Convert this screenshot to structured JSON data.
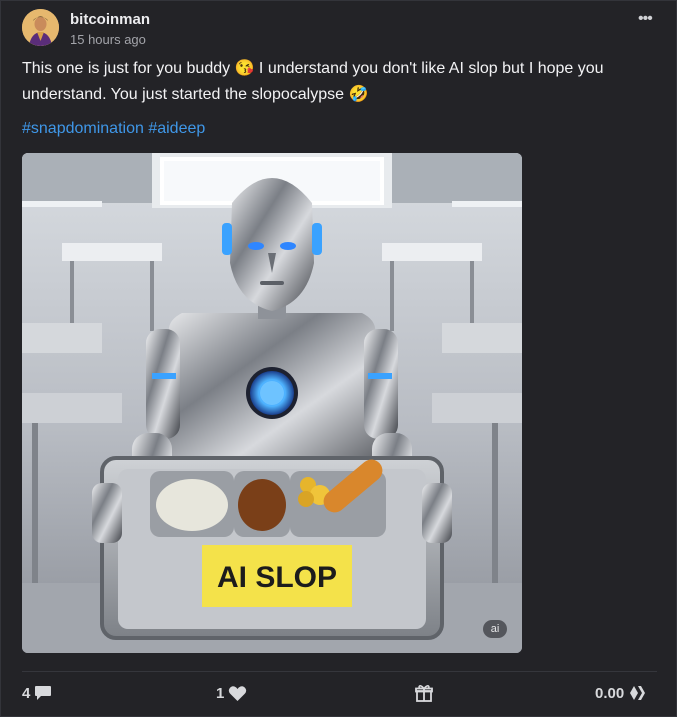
{
  "post": {
    "author": "bitcoinman",
    "time": "15 hours ago",
    "more_icon": "ellipsis-icon",
    "text": "This one is just for you buddy 😘 I understand you don't like AI slop but I hope you understand. You just started the slopocalypse 🤣",
    "tags": [
      "#snapdomination",
      "#aideep"
    ],
    "image": {
      "badge": "ai",
      "sign_text": "AI SLOP"
    }
  },
  "footer": {
    "comments": "4",
    "comment_icon": "comment-icon",
    "likes": "1",
    "like_icon": "heart-icon",
    "gift_icon": "gift-icon",
    "payout": "0.00",
    "hive_icon": "hive-icon"
  },
  "colors": {
    "background": "#232327",
    "hashtag": "#3f97e8",
    "text": "#f2f2f4",
    "muted": "#a3a4aa"
  }
}
